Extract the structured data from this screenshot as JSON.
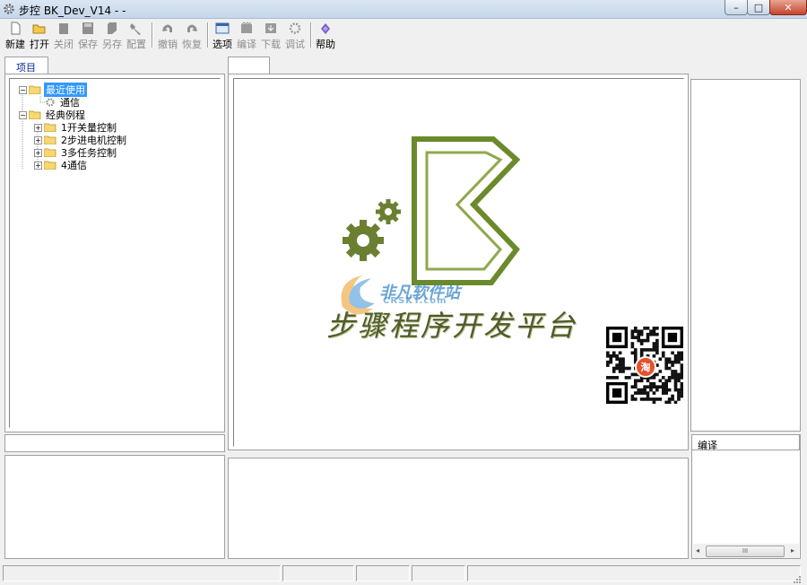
{
  "window": {
    "title": "步控  BK_Dev_V14   -     -",
    "controls": {
      "minimize": "–",
      "maximize": "□",
      "close": "✕"
    }
  },
  "toolbar": {
    "new": "新建",
    "open": "打开",
    "close": "关闭",
    "save": "保存",
    "save_as": "另存",
    "config": "配置",
    "undo": "撤销",
    "redo": "恢复",
    "options": "选项",
    "compile": "编译",
    "download": "下载",
    "debug": "调试",
    "help": "帮助"
  },
  "project_panel": {
    "tab_label": "项目",
    "tree": [
      {
        "label": "最近使用",
        "selected": true
      },
      {
        "label": "通信"
      },
      {
        "label": "经典例程"
      },
      {
        "label": "1开关量控制"
      },
      {
        "label": "2步进电机控制"
      },
      {
        "label": "3多任务控制"
      },
      {
        "label": "4通信"
      }
    ]
  },
  "splash": {
    "title": "步骤程序开发平台",
    "watermark_text": "非凡软件站",
    "watermark_sub": "CRSKY.com",
    "qr_badge": "淘"
  },
  "output_panel": {
    "header": "编译",
    "scrollbar_thumb": "III"
  },
  "colors": {
    "selection": "#3399ff",
    "logo_green": "#6b8a2c",
    "logo_dark": "#4e5a2a",
    "tab_label": "#0a2c9a"
  }
}
